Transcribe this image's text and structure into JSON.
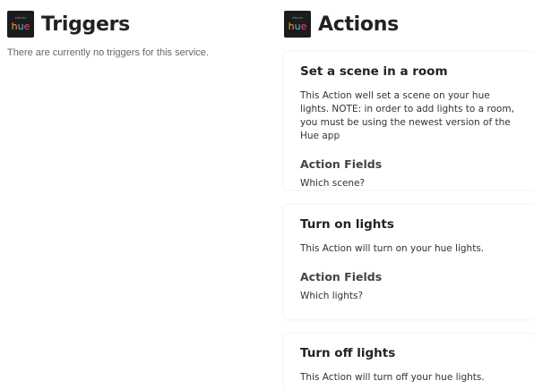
{
  "triggers": {
    "title": "Triggers",
    "empty_message": "There are currently no triggers for this service."
  },
  "actions": {
    "title": "Actions",
    "items": [
      {
        "title": "Set a scene in a room",
        "description": "This Action well set a scene on your hue lights. NOTE: in order to add lights to a room, you must be using the newest version of the Hue app",
        "fields_title": "Action Fields",
        "fields_value": "Which scene?"
      },
      {
        "title": "Turn on lights",
        "description": "This Action will turn on your hue lights.",
        "fields_title": "Action Fields",
        "fields_value": "Which lights?"
      },
      {
        "title": "Turn off lights",
        "description": "This Action will turn off your hue lights."
      }
    ]
  },
  "logo": {
    "brand": "PHILIPS",
    "letters": [
      "h",
      "u",
      "e"
    ],
    "icon": "hue-logo-icon"
  },
  "colors": {
    "logo_bg": "#1c1c1c",
    "hue_h": "#f4a23a",
    "hue_u": "#5fb8e6",
    "hue_e": "#e84e8a"
  }
}
